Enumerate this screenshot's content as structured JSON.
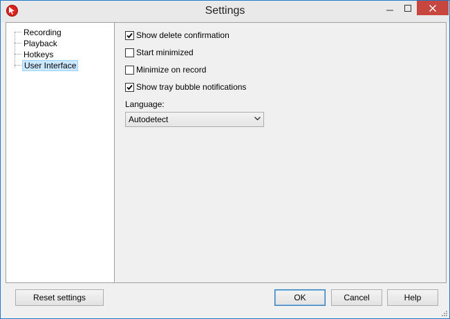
{
  "window": {
    "title": "Settings"
  },
  "titlebar_icons": {
    "app": "app-record-icon",
    "minimize": "minimize-icon",
    "maximize": "maximize-icon",
    "close": "close-icon"
  },
  "tree": {
    "items": [
      {
        "label": "Recording",
        "selected": false
      },
      {
        "label": "Playback",
        "selected": false
      },
      {
        "label": "Hotkeys",
        "selected": false
      },
      {
        "label": "User Interface",
        "selected": true
      }
    ]
  },
  "options": [
    {
      "label": "Show delete confirmation",
      "checked": true
    },
    {
      "label": "Start minimized",
      "checked": false
    },
    {
      "label": "Minimize on record",
      "checked": false
    },
    {
      "label": "Show tray bubble notifications",
      "checked": true
    }
  ],
  "language": {
    "label": "Language:",
    "value": "Autodetect"
  },
  "buttons": {
    "reset": "Reset settings",
    "ok": "OK",
    "cancel": "Cancel",
    "help": "Help"
  },
  "colors": {
    "close_button": "#c7463f",
    "selection": "#cce8ff",
    "app_icon": "#d9231d"
  }
}
